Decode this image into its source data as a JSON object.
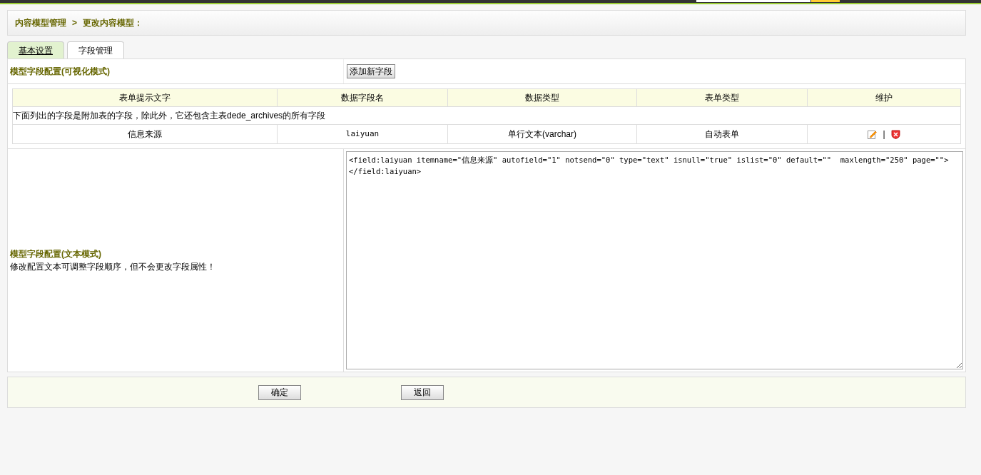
{
  "breadcrumb": {
    "parent": "内容模型管理",
    "separator": ">",
    "current": "更改内容模型："
  },
  "tabs": [
    {
      "label": "基本设置",
      "selected": false
    },
    {
      "label": "字段管理",
      "selected": true
    }
  ],
  "visual_section": {
    "title": "模型字段配置(可视化模式)",
    "add_button": "添加新字段"
  },
  "table": {
    "columns": [
      "表单提示文字",
      "数据字段名",
      "数据类型",
      "表单类型",
      "维护"
    ],
    "note": "下面列出的字段是附加表的字段，除此外，它还包含主表dede_archives的所有字段",
    "rows": [
      {
        "label": "信息来源",
        "field": "laiyuan",
        "data_type": "单行文本(varchar)",
        "form_type": "自动表单",
        "separator": "|"
      }
    ]
  },
  "text_section": {
    "title": "模型字段配置(文本模式)",
    "description": "修改配置文本可调整字段顺序，但不会更改字段属性！",
    "config": "<field:laiyuan itemname=\"信息来源\" autofield=\"1\" notsend=\"0\" type=\"text\" isnull=\"true\" islist=\"0\" default=\"\"  maxlength=\"250\" page=\"\">\n</field:laiyuan>"
  },
  "buttons": [
    "确定",
    "返回"
  ]
}
